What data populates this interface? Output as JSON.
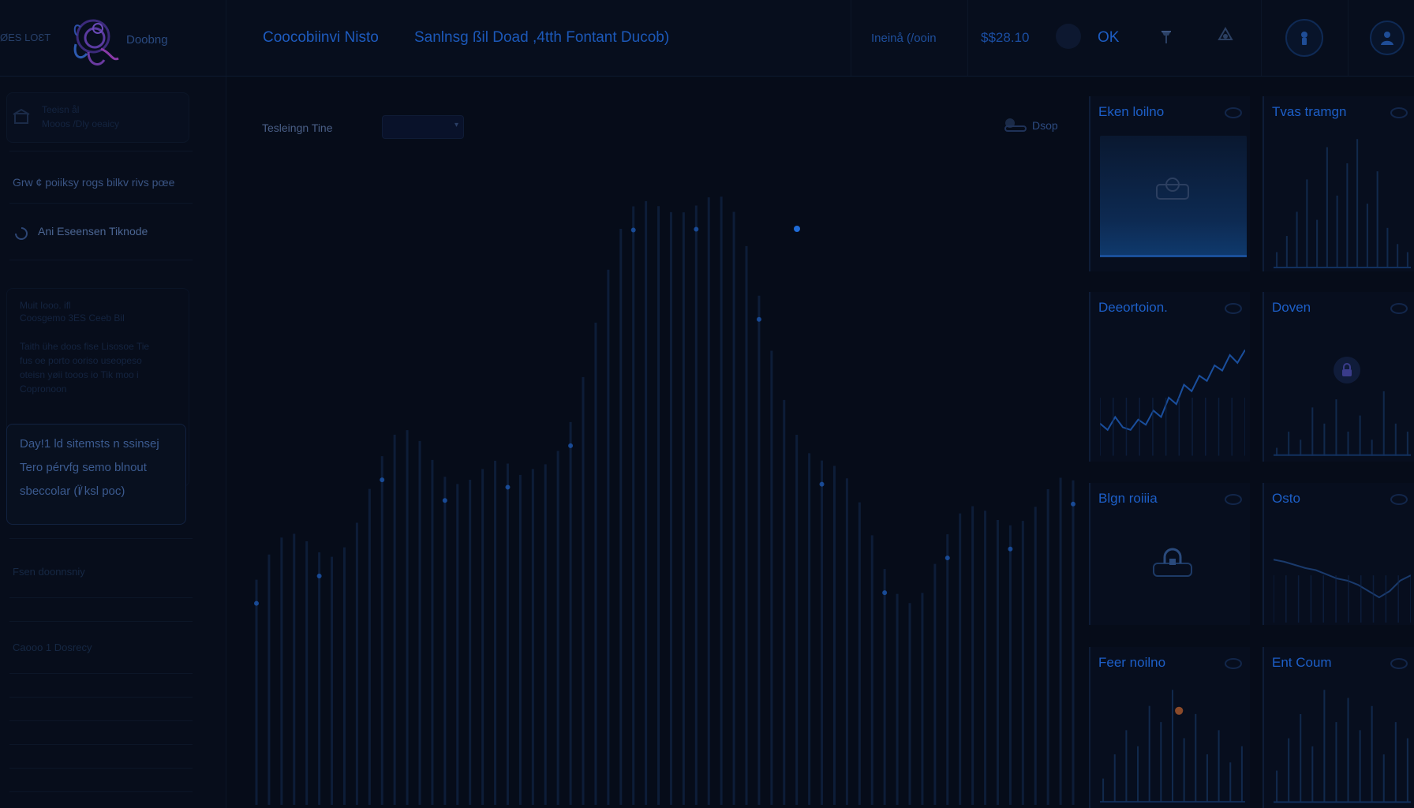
{
  "header": {
    "brand_left": "ØES LOƐT",
    "brand_right": "Doobng",
    "title": "Coocobiinvi Nisto",
    "subtitle": "Sanlnsg ßil Doad ,4tth Fontant Ducob)",
    "status_left": "Ineinå (/ooin",
    "status_value": "$$28.10",
    "status_ok": "OK",
    "icons": [
      "pin-icon",
      "recycle-icon",
      "account-icon",
      "profile-icon"
    ]
  },
  "sidebar": {
    "card1_line1": "Teeisn ål",
    "card1_line2": "Mooos /Dly oeaicy",
    "line_plain": "Grw ¢ poiiksy rogs bilkv rivs pœe",
    "item_icon_label": "Ani Eseensen Tiknode",
    "card2_line1": "Muit Iooo. ifl",
    "card2_line2": "Coosgemo 3ES Ceeb Bil",
    "card2_para": [
      "Taith ühe doos fise Lisosoe Tie",
      "fus oe porto ooriso useopeso",
      "oteisn yøii tooos io Tik moo i",
      "Copronoon"
    ],
    "card3_lines": [
      "Day!1 ld sitemsts n ssinsej",
      "Tero pérvfg semo blnout",
      "sbeccolar (Ï̸ ksl poc)"
    ],
    "section_a": "Fsen doonnsniy",
    "section_b": "Caooo 1 Dosrecy"
  },
  "main": {
    "select_label": "Tesleingn Tine",
    "drop_label": "Dsop"
  },
  "panels": [
    {
      "title": "Eken loilno"
    },
    {
      "title": "Tvas tramgn"
    },
    {
      "title": "Deeortoion."
    },
    {
      "title": "Doven"
    },
    {
      "title": "Blgn roiiia"
    },
    {
      "title": "Osto"
    },
    {
      "title": "Feer noilno"
    },
    {
      "title": "Ent Coum"
    }
  ],
  "colors": {
    "background": "#060c19",
    "accent": "#1d5fc8",
    "bar": "#17335e",
    "highlight": "#1f6bd6",
    "orange_point": "#8a4a2a"
  }
}
